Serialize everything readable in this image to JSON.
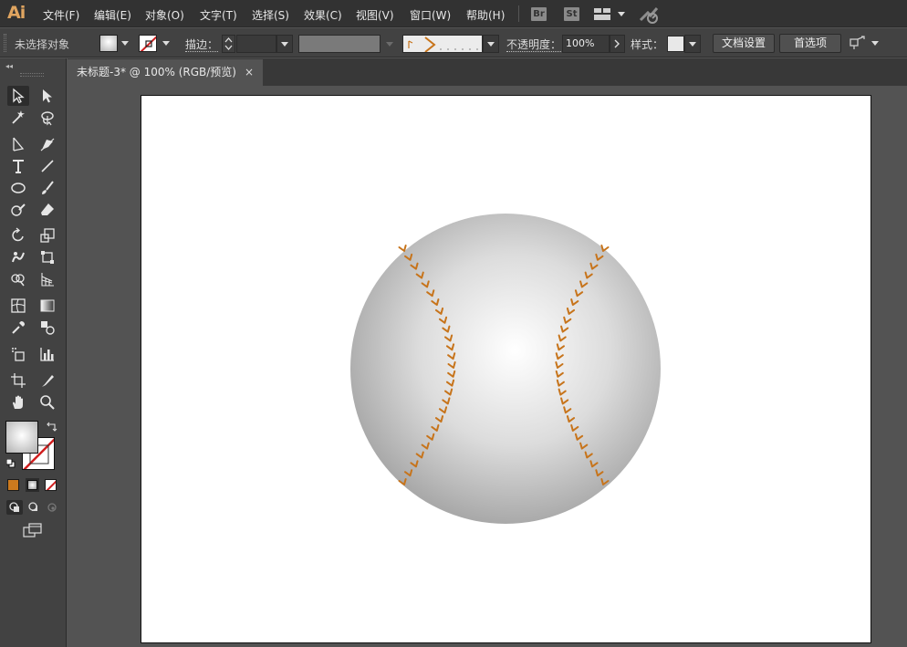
{
  "app": {
    "logo": "Ai"
  },
  "menu": [
    {
      "label": "文件(F)"
    },
    {
      "label": "编辑(E)"
    },
    {
      "label": "对象(O)"
    },
    {
      "label": "文字(T)"
    },
    {
      "label": "选择(S)"
    },
    {
      "label": "效果(C)"
    },
    {
      "label": "视图(V)"
    },
    {
      "label": "窗口(W)"
    },
    {
      "label": "帮助(H)"
    }
  ],
  "menu_buttons": {
    "bridge": "Br",
    "stock": "St"
  },
  "control": {
    "selection_status": "未选择对象",
    "stroke_label": "描边：",
    "opacity_label": "不透明度：",
    "opacity_value": "100%",
    "style_label": "样式：",
    "doc_setup": "文档设置",
    "preferences": "首选项"
  },
  "document": {
    "tab_title": "未标题-3* @ 100% (RGB/预览)",
    "close": "×"
  },
  "colors": {
    "accent": "#cc7a1e",
    "stitch": "#c7741b",
    "ui_dark": "#323232"
  },
  "icons": [
    "selection-tool",
    "direct-selection-tool",
    "magic-wand",
    "lasso",
    "pen",
    "curvature",
    "type",
    "line-segment",
    "ellipse",
    "paintbrush",
    "shaper",
    "eraser",
    "rotate",
    "scale",
    "warp",
    "free-transform",
    "shape-builder",
    "perspective-grid",
    "mesh",
    "gradient",
    "eyedropper",
    "blend",
    "symbol-sprayer",
    "column-graph",
    "artboard",
    "slice",
    "hand",
    "zoom"
  ]
}
